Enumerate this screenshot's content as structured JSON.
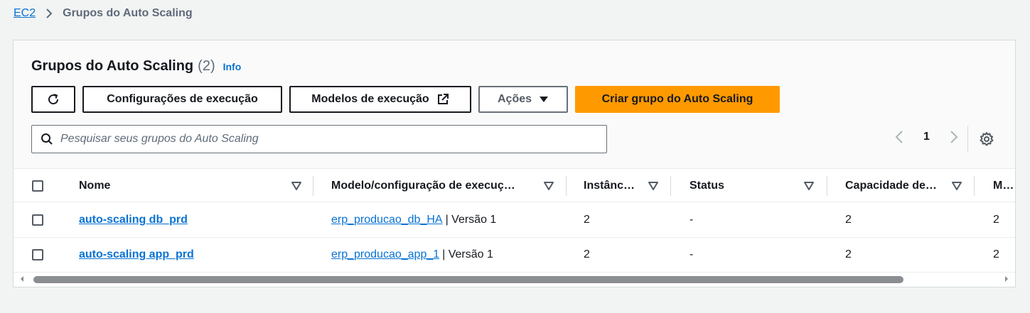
{
  "breadcrumb": {
    "root": "EC2",
    "current": "Grupos do Auto Scaling"
  },
  "header": {
    "title": "Grupos do Auto Scaling",
    "count": "(2)",
    "info": "Info"
  },
  "toolbar": {
    "refresh_icon": "refresh-icon",
    "launch_configurations": "Configurações de execução",
    "launch_templates": "Modelos de execução",
    "actions": "Ações",
    "create": "Criar grupo do Auto Scaling"
  },
  "search": {
    "placeholder": "Pesquisar seus grupos do Auto Scaling",
    "value": ""
  },
  "pagination": {
    "page": "1"
  },
  "table": {
    "columns": [
      "Nome",
      "Modelo/configuração de execuç…",
      "Instânc…",
      "Status",
      "Capacidade de…",
      "M…"
    ],
    "rows": [
      {
        "name": "auto-scaling db_prd",
        "template": "erp_producao_db_HA",
        "version": "| Versão 1",
        "instances": "2",
        "status": "-",
        "capacity": "2",
        "more": "2"
      },
      {
        "name": "auto-scaling app_prd",
        "template": "erp_producao_app_1",
        "version": "| Versão 1",
        "instances": "2",
        "status": "-",
        "capacity": "2",
        "more": "2"
      }
    ]
  },
  "colors": {
    "link": "#0972d3",
    "primary": "#ff9900",
    "background": "#f2f3f3"
  }
}
